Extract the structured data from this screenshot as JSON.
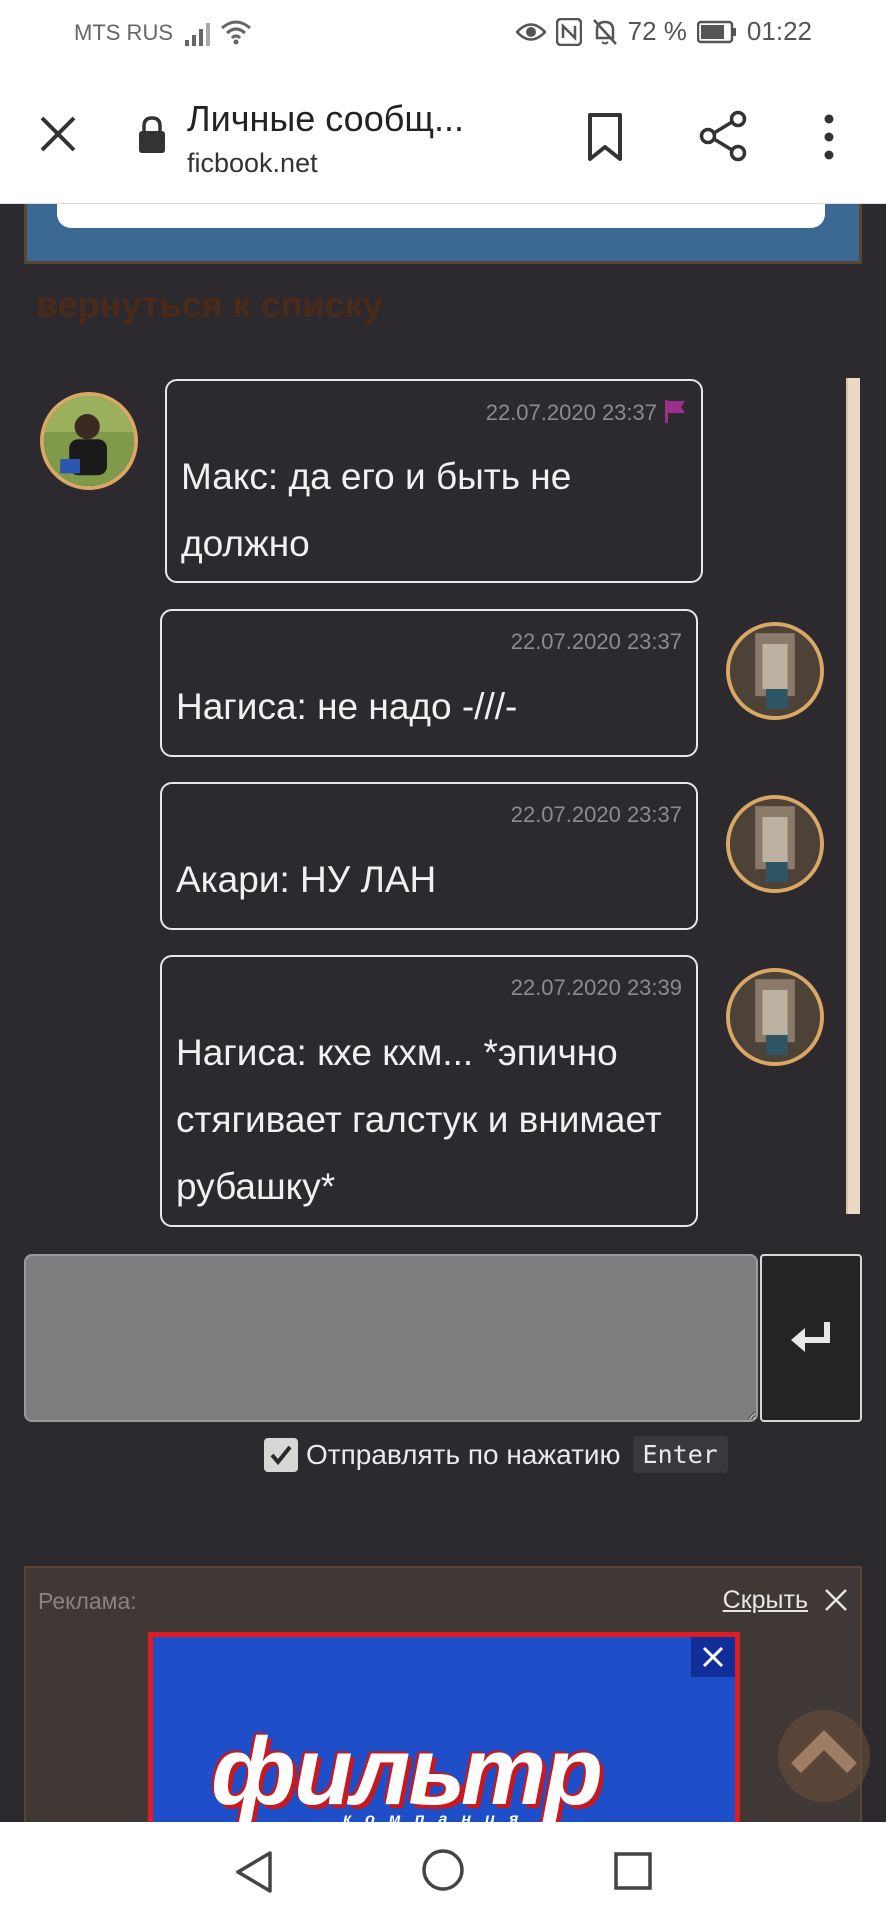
{
  "status_bar": {
    "carrier": "MTS RUS",
    "battery_percent": "72 %",
    "time": "01:22"
  },
  "browser": {
    "title": "Личные сообщ...",
    "url": "ficbook.net"
  },
  "back_link": "вернуться к списку",
  "messages": [
    {
      "timestamp": "22.07.2020 23:37",
      "text": "Макс: да его и быть не должно",
      "side": "left"
    },
    {
      "timestamp": "22.07.2020 23:37",
      "text": "Нагиса: не надо -///-",
      "side": "right"
    },
    {
      "timestamp": "22.07.2020 23:37",
      "text": "Акари: НУ ЛАН",
      "side": "right"
    },
    {
      "timestamp": "22.07.2020 23:39",
      "text": "Нагиса: кхе кхм... *эпично стягивает галстук и внимает рубашку*",
      "side": "right"
    }
  ],
  "composer": {
    "placeholder": "",
    "enter_option_label": "Отправлять по нажатию",
    "enter_key": "Enter",
    "enter_option_checked": true
  },
  "ad": {
    "label": "Реклама:",
    "hide_label": "Скрыть",
    "banner_logo": "фильтр",
    "banner_sub": "компания"
  },
  "colors": {
    "page_bg": "#2c2a2e",
    "avatar_border": "#d9a865",
    "flag": "#9c2f8c",
    "back_link": "#4a2b1a"
  }
}
